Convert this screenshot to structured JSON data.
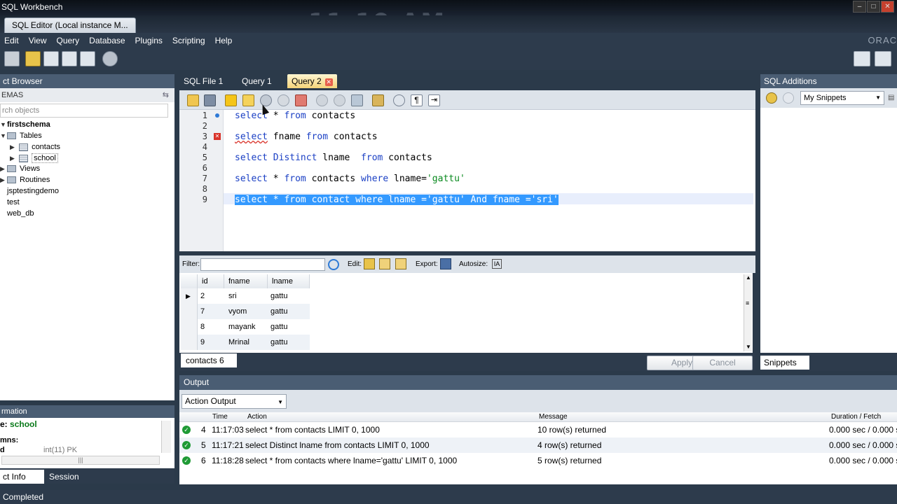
{
  "window": {
    "title": "SQL Workbench"
  },
  "doc_tab": {
    "label": "SQL Editor (Local instance M..."
  },
  "brand": {
    "oracle": "ORAC"
  },
  "menu": [
    "Edit",
    "View",
    "Query",
    "Database",
    "Plugins",
    "Scripting",
    "Help"
  ],
  "left_panel": {
    "header": "ct Browser",
    "schemas_label": "EMAS",
    "search_placeholder": "rch objects",
    "tree": {
      "schema": "firstschema",
      "tables": "Tables",
      "table_items": [
        "contacts",
        "school"
      ],
      "views": "Views",
      "routines": "Routines",
      "other_schemas": [
        "jsptestingdemo",
        "test",
        "web_db"
      ]
    }
  },
  "info_panel": {
    "header": "rmation",
    "table_label": "e:",
    "table_name": "school",
    "columns_label": "mns:",
    "col_name": "d",
    "col_type": "int(11) PK",
    "tabs": [
      "ct Info",
      "Session"
    ]
  },
  "status": "Completed",
  "query_tabs": [
    {
      "label": "SQL File 1"
    },
    {
      "label": "Query 1"
    },
    {
      "label": "Query 2",
      "active": true
    }
  ],
  "editor": {
    "line_numbers": [
      "1",
      "2",
      "3",
      "4",
      "5",
      "6",
      "7",
      "8",
      "9"
    ],
    "line1": {
      "a": "select",
      "b": " * ",
      "c": "from",
      "d": " contacts"
    },
    "line3": {
      "a": "select",
      "b": " fname ",
      "c": "from",
      "d": " contacts"
    },
    "line5": {
      "a": "select",
      "b": " ",
      "c": "Distinct",
      "d": " lname  ",
      "e": "from",
      "f": " contacts"
    },
    "line7": {
      "a": "select",
      "b": " * ",
      "c": "from",
      "d": " contacts ",
      "e": "where",
      "f": " lname=",
      "g": "'gattu'"
    },
    "line9": "select * from contact where lname ='gattu' And fname ='sri'"
  },
  "result_toolbar": {
    "filter": "Filter:",
    "edit": "Edit:",
    "export": "Export:",
    "autosize": "Autosize:"
  },
  "result_grid": {
    "columns": [
      "id",
      "fname",
      "lname"
    ],
    "rows": [
      [
        "2",
        "sri",
        "gattu"
      ],
      [
        "7",
        "vyom",
        "gattu"
      ],
      [
        "8",
        "mayank",
        "gattu"
      ],
      [
        "9",
        "Mrinal",
        "gattu"
      ]
    ]
  },
  "result_tab": "contacts 6",
  "buttons": {
    "apply": "Apply",
    "cancel": "Cancel"
  },
  "right_panel": {
    "header": "SQL Additions",
    "select": "My Snippets",
    "tab": "Snippets"
  },
  "output": {
    "header": "Output",
    "select": "Action Output",
    "columns": [
      "Time",
      "Action",
      "Message",
      "Duration / Fetch"
    ],
    "rows": [
      {
        "n": "4",
        "time": "11:17:03",
        "action": "select * from contacts LIMIT 0, 1000",
        "message": "10 row(s) returned",
        "duration": "0.000 sec / 0.000 se"
      },
      {
        "n": "5",
        "time": "11:17:21",
        "action": "select Distinct lname  from contacts LIMIT 0, 1000",
        "message": "4 row(s) returned",
        "duration": "0.000 sec / 0.000 se"
      },
      {
        "n": "6",
        "time": "11:18:28",
        "action": "select * from contacts where lname='gattu' LIMIT 0, 1000",
        "message": "5 row(s) returned",
        "duration": "0.000 sec / 0.000 se"
      }
    ]
  },
  "colors": {
    "chrome": "#2d3b4c",
    "panel_header": "#4a5d73",
    "selection": "#3399ff",
    "keyword": "#1a3fc4",
    "string": "#0a8a1f",
    "active_tab": "#f4d47a"
  }
}
